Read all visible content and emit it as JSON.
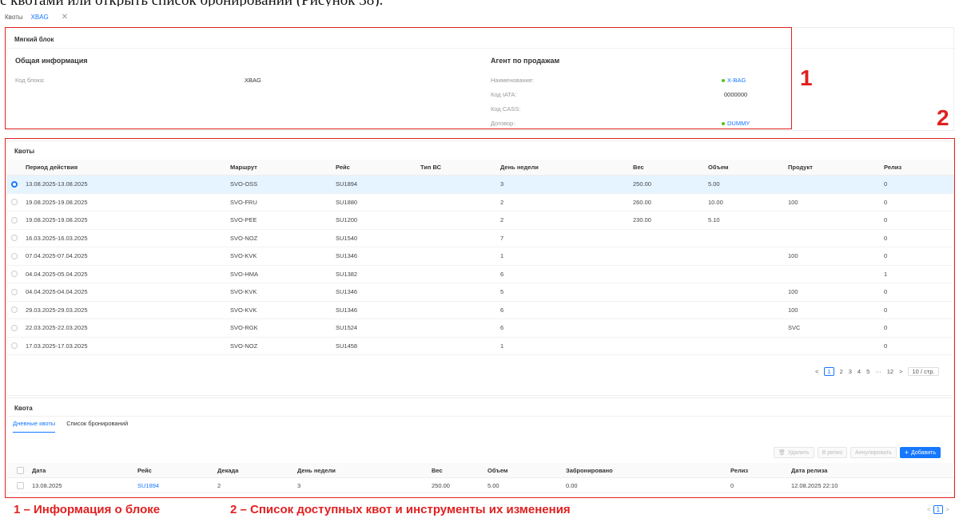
{
  "caption": "с квотами или открыть список бронирований (Рисунок 38).",
  "tabs": [
    {
      "label": "Квоты",
      "active": false
    },
    {
      "label": "XBAG",
      "active": true
    }
  ],
  "block": {
    "title": "Мягкий блок",
    "general": {
      "heading": "Общая информация",
      "code_label": "Код блока:",
      "code_value": "XBAG"
    },
    "agent": {
      "heading": "Агент по продажам",
      "fields": [
        {
          "label": "Наименование:",
          "value": "X-BAG",
          "dot": true,
          "link": true
        },
        {
          "label": "Код IATA:",
          "value": "0000000",
          "dot": false,
          "link": false
        },
        {
          "label": "Код CASS:",
          "value": "",
          "dot": false,
          "link": false
        },
        {
          "label": "Договор:",
          "value": "DUMMY",
          "dot": true,
          "link": true
        }
      ]
    }
  },
  "quotas": {
    "title": "Квоты",
    "columns": [
      "Период действия",
      "Маршрут",
      "Рейс",
      "Тип ВС",
      "День недели",
      "Вес",
      "Объем",
      "Продукт",
      "Релиз"
    ],
    "rows": [
      {
        "selected": true,
        "cells": [
          "13.08.2025-13.08.2025",
          "SVO-OSS",
          "SU1894",
          "",
          "3",
          "250.00",
          "5.00",
          "",
          "0"
        ]
      },
      {
        "selected": false,
        "cells": [
          "19.08.2025-19.08.2025",
          "SVO-FRU",
          "SU1880",
          "",
          "2",
          "260.00",
          "10.00",
          "100",
          "0"
        ]
      },
      {
        "selected": false,
        "cells": [
          "19.08.2025-19.08.2025",
          "SVO-PEE",
          "SU1200",
          "",
          "2",
          "230.00",
          "5.10",
          "",
          "0"
        ]
      },
      {
        "selected": false,
        "cells": [
          "16.03.2025-16.03.2025",
          "SVO-NOZ",
          "SU1540",
          "",
          "7",
          "",
          "",
          "",
          "0"
        ]
      },
      {
        "selected": false,
        "cells": [
          "07.04.2025-07.04.2025",
          "SVO-KVK",
          "SU1346",
          "",
          "1",
          "",
          "",
          "100",
          "0"
        ]
      },
      {
        "selected": false,
        "cells": [
          "04.04.2025-05.04.2025",
          "SVO-HMA",
          "SU1382",
          "",
          "6",
          "",
          "",
          "",
          "1"
        ]
      },
      {
        "selected": false,
        "cells": [
          "04.04.2025-04.04.2025",
          "SVO-KVK",
          "SU1346",
          "",
          "5",
          "",
          "",
          "100",
          "0"
        ]
      },
      {
        "selected": false,
        "cells": [
          "29.03.2025-29.03.2025",
          "SVO-KVK",
          "SU1346",
          "",
          "6",
          "",
          "",
          "100",
          "0"
        ]
      },
      {
        "selected": false,
        "cells": [
          "22.03.2025-22.03.2025",
          "SVO-RGK",
          "SU1524",
          "",
          "6",
          "",
          "",
          "SVC",
          "0"
        ]
      },
      {
        "selected": false,
        "cells": [
          "17.03.2025-17.03.2025",
          "SVO-NOZ",
          "SU1458",
          "",
          "1",
          "",
          "",
          "",
          "0"
        ]
      }
    ],
    "pager": {
      "prev": "<",
      "pages": [
        "1",
        "2",
        "3",
        "4",
        "5"
      ],
      "current": "1",
      "ellipsis": "···",
      "last": "12",
      "next": ">",
      "size": "10 / стр."
    }
  },
  "quota": {
    "title": "Квота",
    "subtabs": [
      {
        "label": "Дневные квоты",
        "active": true
      },
      {
        "label": "Список бронирований",
        "active": false
      }
    ],
    "toolbar": {
      "delete": "Удалить",
      "release": "В релиз",
      "cancel": "Аннулировать",
      "add": "Добавить"
    },
    "columns": [
      "Дата",
      "Рейс",
      "Декада",
      "День недели",
      "Вес",
      "Объем",
      "Забронировано",
      "Релиз",
      "Дата релиза"
    ],
    "rows": [
      {
        "cells": [
          "13.08.2025",
          "SU1894",
          "2",
          "3",
          "250.00",
          "5.00",
          "0.00",
          "0",
          "12.08.2025 22:10"
        ]
      }
    ],
    "mini_pager": {
      "prev": "<",
      "current": "1",
      "next": ">"
    }
  },
  "annotations": {
    "mark1": "1",
    "mark2": "2",
    "legend1": "1 – Информация о блоке",
    "legend2": "2 – Список доступных квот и инструменты их изменения",
    "color": "#e02020"
  },
  "colors": {
    "accent": "#1677ff",
    "status_green": "#52c41a",
    "annotation_red": "#e02020"
  }
}
